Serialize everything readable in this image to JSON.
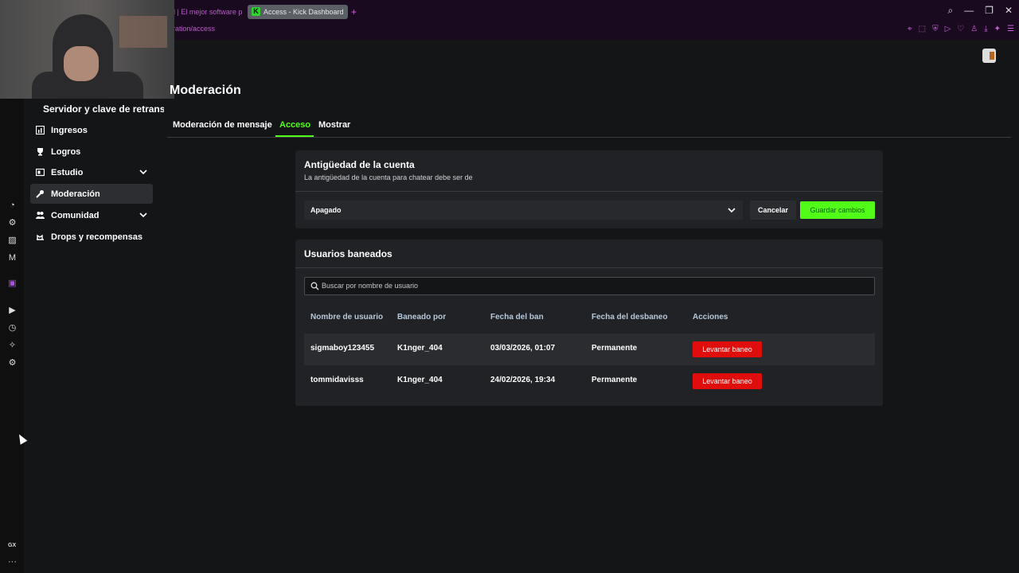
{
  "browser": {
    "tabs": [
      {
        "label": "il | El mejor software p"
      },
      {
        "label": "Access - Kick Dashboard",
        "favicon": "K"
      }
    ],
    "new_tab": "+",
    "url": "eration/access",
    "gx_label": "GX",
    "more": "···"
  },
  "sidebar": {
    "top_label": "Servidor y clave de retransm",
    "items": [
      {
        "label": "Ingresos",
        "icon": "chart-icon"
      },
      {
        "label": "Logros",
        "icon": "trophy-icon"
      },
      {
        "label": "Estudio",
        "icon": "studio-icon"
      },
      {
        "label": "Moderación",
        "icon": "wrench-icon"
      },
      {
        "label": "Comunidad",
        "icon": "community-icon"
      },
      {
        "label": "Drops y recompensas",
        "icon": "drops-icon"
      }
    ]
  },
  "main": {
    "title": "Moderación",
    "tabs": [
      {
        "label": "Moderación de mensaje"
      },
      {
        "label": "Acceso"
      },
      {
        "label": "Mostrar"
      }
    ]
  },
  "account_age": {
    "title": "Antigüedad de la cuenta",
    "description": "La antigüedad de la cuenta para chatear debe ser de",
    "selected": "Apagado",
    "cancel_label": "Cancelar",
    "save_label": "Guardar cambios"
  },
  "banned": {
    "title": "Usuarios baneados",
    "search_placeholder": "Buscar por nombre de usuario",
    "columns": [
      "Nombre de usuario",
      "Baneado por",
      "Fecha del ban",
      "Fecha del desbaneo",
      "Acciones"
    ],
    "rows": [
      {
        "username": "sigmaboy123455",
        "banned_by": "K1nger_404",
        "ban_date": "03/03/2026, 01:07",
        "unban_date": "Permanente",
        "action": "Levantar baneo"
      },
      {
        "username": "tommidavisss",
        "banned_by": "K1nger_404",
        "ban_date": "24/02/2026, 19:34",
        "unban_date": "Permanente",
        "action": "Levantar baneo"
      }
    ]
  },
  "colors": {
    "accent": "#53fc18",
    "danger": "#e00d0d",
    "opera": "#c760d6"
  }
}
